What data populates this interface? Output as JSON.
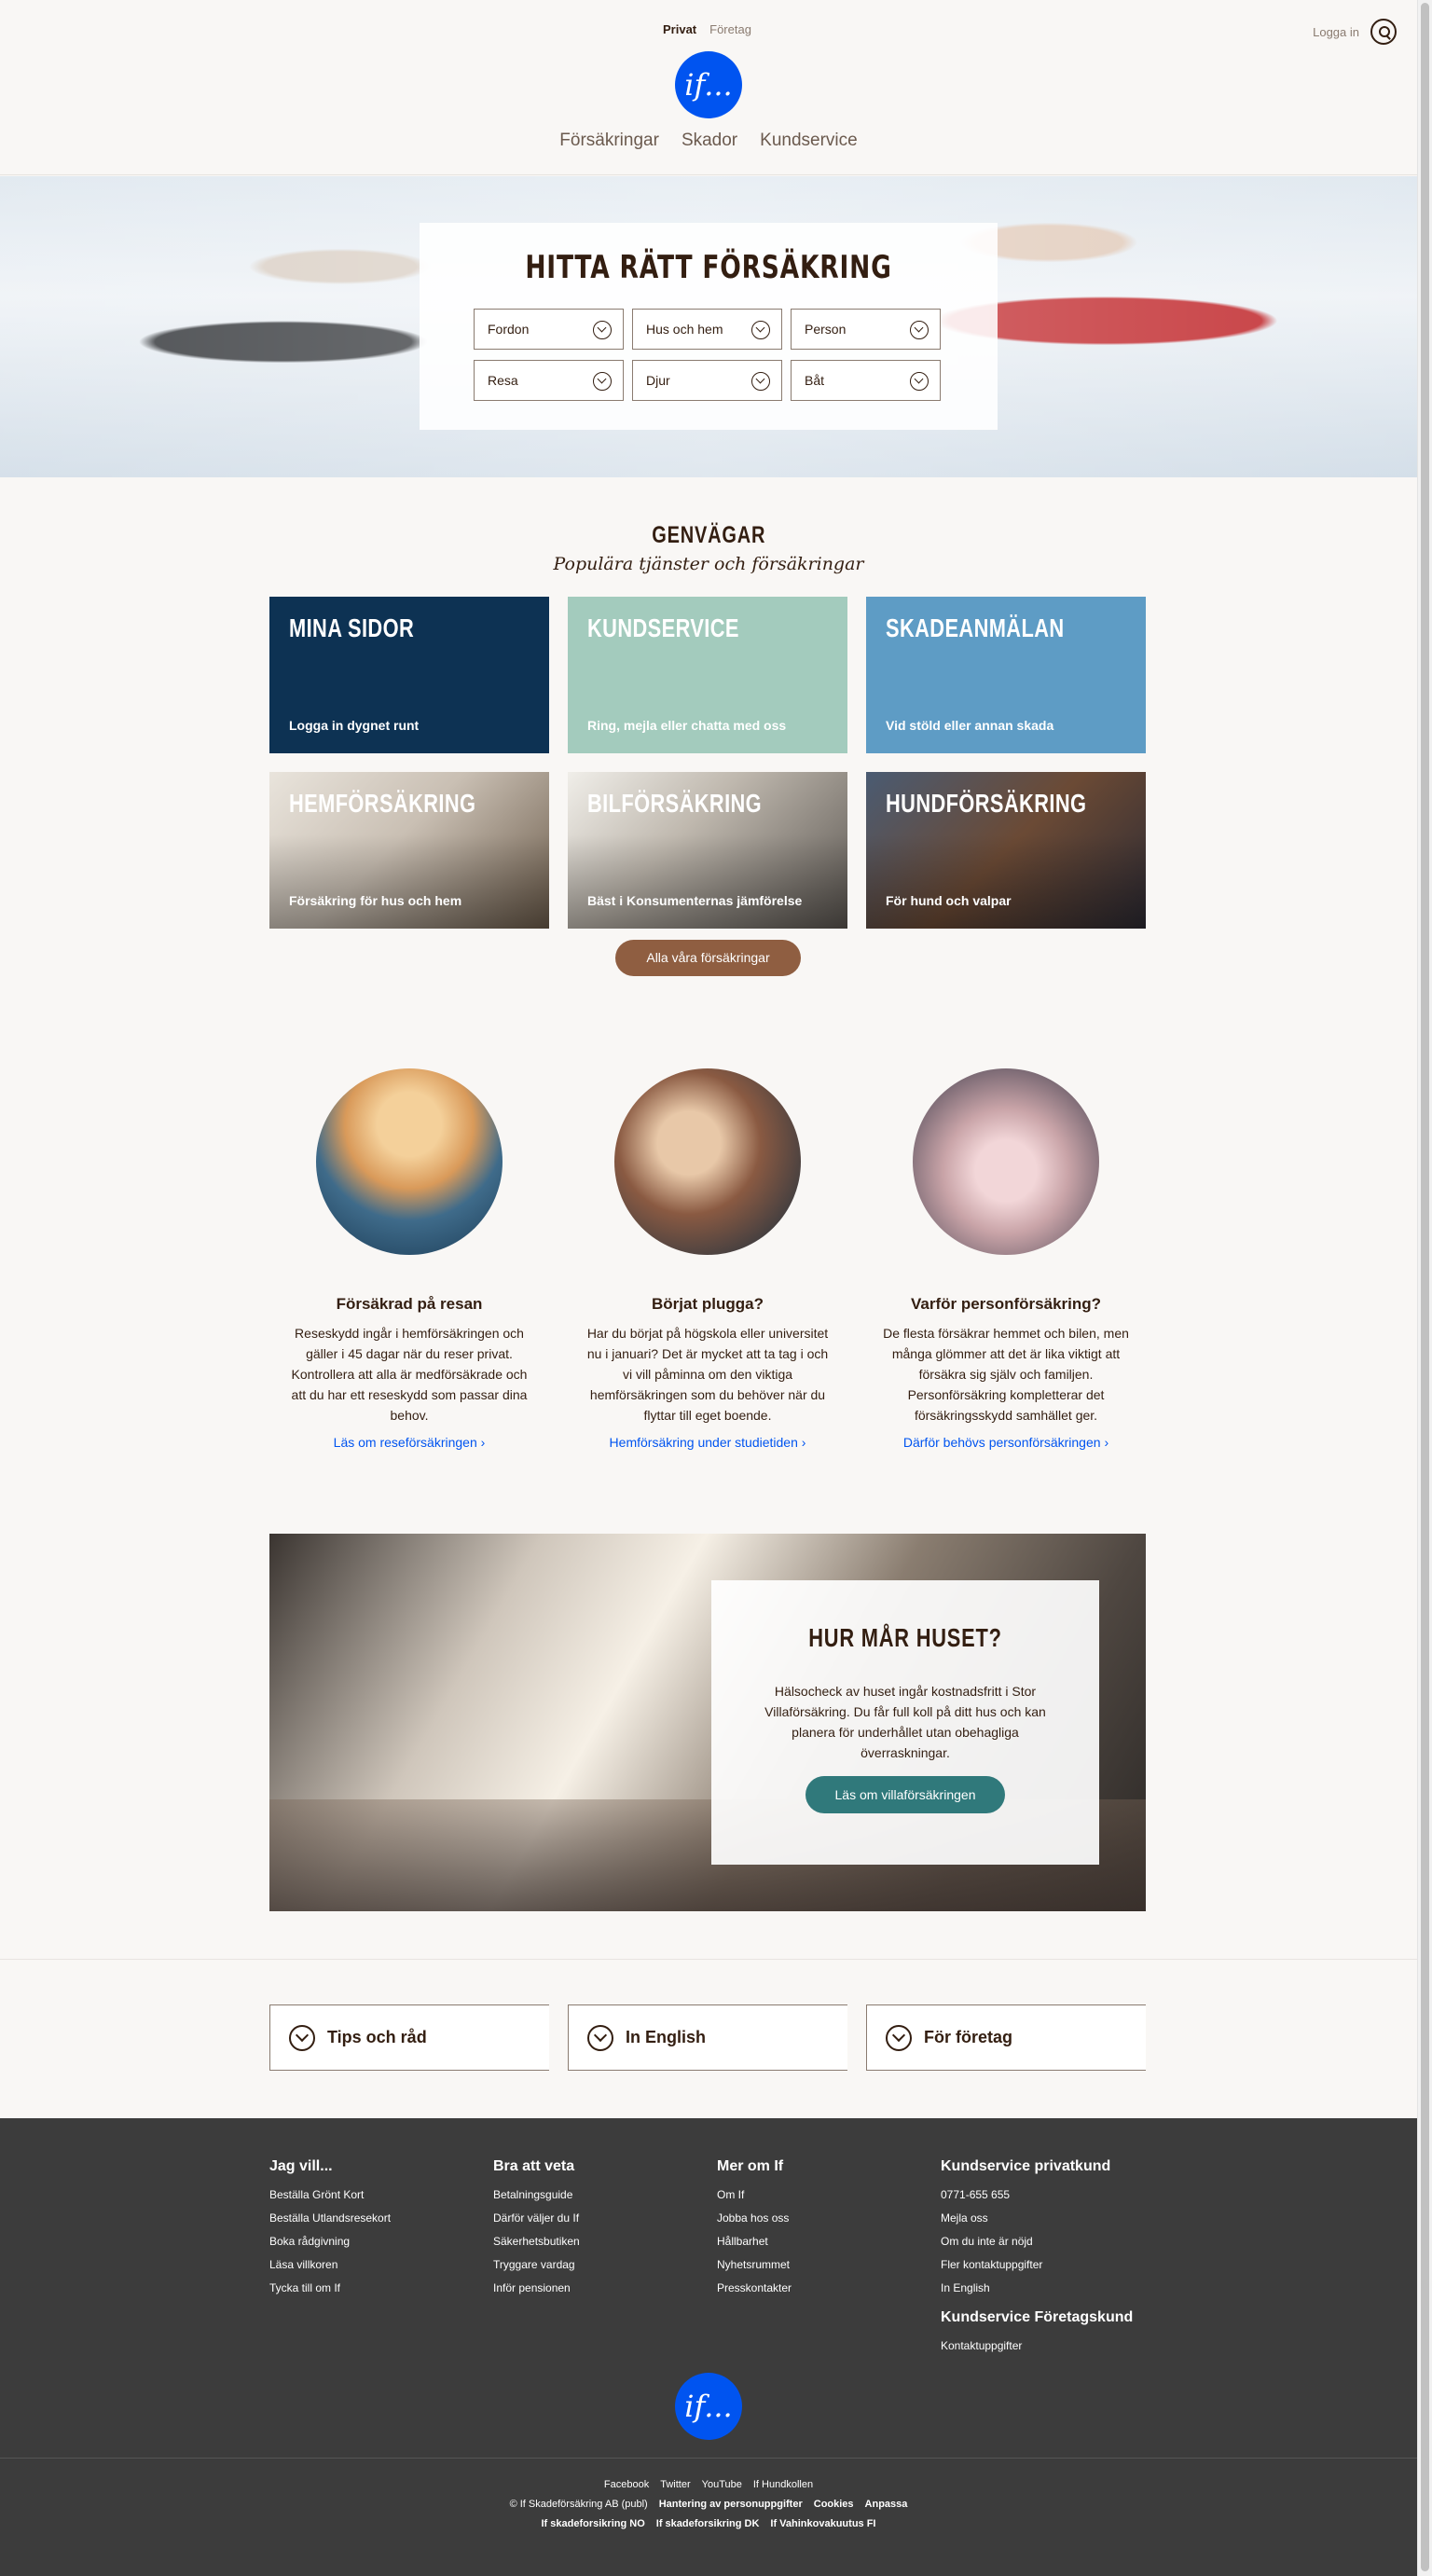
{
  "header": {
    "segments": [
      "Privat",
      "Företag"
    ],
    "login": "Logga in",
    "logo_text": "if...",
    "nav": [
      "Försäkringar",
      "Skador",
      "Kundservice"
    ]
  },
  "hero": {
    "title": "HITTA RÄTT FÖRSÄKRING",
    "selects": [
      "Fordon",
      "Hus och hem",
      "Person",
      "Resa",
      "Djur",
      "Båt"
    ]
  },
  "shortcuts": {
    "title": "GENVÄGAR",
    "subtitle": "Populära tjänster och försäkringar",
    "tiles": [
      {
        "title": "MINA SIDOR",
        "sub": "Logga in dygnet runt"
      },
      {
        "title": "KUNDSERVICE",
        "sub": "Ring, mejla eller chatta med oss"
      },
      {
        "title": "SKADEANMÄLAN",
        "sub": "Vid stöld eller annan skada"
      },
      {
        "title": "HEMFÖRSÄKRING",
        "sub": "Försäkring för hus och hem"
      },
      {
        "title": "BILFÖRSÄKRING",
        "sub": "Bäst i Konsumenternas jämförelse"
      },
      {
        "title": "HUNDFÖRSÄKRING",
        "sub": "För hund och valpar"
      }
    ],
    "all_button": "Alla våra försäkringar"
  },
  "articles": [
    {
      "title": "Försäkrad på resan",
      "text": "Reseskydd ingår i hemförsäkringen och gäller i 45 dagar när du reser privat. Kontrollera att alla är medförsäkrade och att du har ett reseskydd som passar dina behov.",
      "link": "Läs om reseförsäkringen"
    },
    {
      "title": "Börjat plugga?",
      "text": "Har du börjat på högskola eller universitet nu i januari? Det är mycket att ta tag i och vi vill påminna om den viktiga hemförsäkringen som du behöver när du flyttar till eget boende.",
      "link": "Hemförsäkring under studietiden"
    },
    {
      "title": "Varför personförsäkring?",
      "text": "De flesta försäkrar hemmet och bilen, men många glömmer att det är lika viktigt att försäkra sig själv och familjen. Personförsäkring kompletterar det försäkringsskydd samhället ger.",
      "link": "Därför behövs personförsäkringen"
    }
  ],
  "feature": {
    "title": "HUR MÅR HUSET?",
    "text": "Hälsocheck av huset ingår kostnadsfritt i Stor Villaförsäkring. Du får full koll på ditt hus och kan planera för underhållet utan obehagliga överraskningar.",
    "button": "Läs om villaförsäkringen"
  },
  "accordions": [
    "Tips och råd",
    "In English",
    "För företag"
  ],
  "footer": {
    "cols": [
      {
        "title": "Jag vill...",
        "links": [
          "Beställa Grönt Kort",
          "Beställa Utlandsresekort",
          "Boka rådgivning",
          "Läsa villkoren",
          "Tycka till om If"
        ]
      },
      {
        "title": "Bra att veta",
        "links": [
          "Betalningsguide",
          "Därför väljer du If",
          "Säkerhetsbutiken",
          "Tryggare vardag",
          "Inför pensionen"
        ]
      },
      {
        "title": "Mer om If",
        "links": [
          "Om If",
          "Jobba hos oss",
          "Hållbarhet",
          "Nyhetsrummet",
          "Presskontakter"
        ]
      },
      {
        "title": "Kundservice privatkund",
        "links": [
          "0771-655 655",
          "Mejla oss",
          "Om du inte är nöjd",
          "Fler kontaktuppgifter",
          "In English"
        ],
        "title2": "Kundservice Företagskund",
        "links2": [
          "Kontaktuppgifter"
        ]
      }
    ],
    "logo_text": "if...",
    "social": [
      "Facebook",
      "Twitter",
      "YouTube",
      "If Hundkollen"
    ],
    "copyright": "© If Skadeförsäkring AB (publ)",
    "legal": [
      "Hantering av personuppgifter",
      "Cookies",
      "Anpassa"
    ],
    "regional": [
      "If skadeforsikring NO",
      "If skadeforsikring DK",
      "If Vahinkovakuutus FI"
    ]
  }
}
